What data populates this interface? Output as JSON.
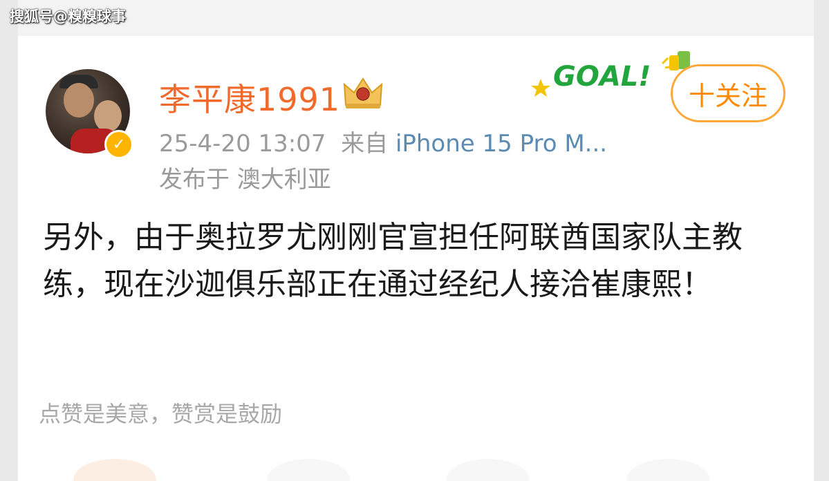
{
  "watermark": "搜狐号@糗糗球事",
  "post": {
    "username": "李平康1991",
    "timestamp": "25-4-20 13:07",
    "source_prefix": "来自",
    "device": "iPhone 15 Pro M...",
    "location": "发布于 澳大利亚",
    "text": "另外，由于奥拉罗尤刚刚官宣担任阿联酋国家队主教练，现在沙迦俱乐部正在通过经纪人接洽崔康熙！",
    "goal_badge": "GOAL!",
    "follow_label": "十关注",
    "reward_tip": "点赞是美意，赞赏是鼓励"
  },
  "colors": {
    "username": "#f06a2c",
    "follow_border": "#ffa83a",
    "follow_text": "#ff8a00",
    "goal_text": "#22a53c",
    "device_link": "#5b8ab3"
  },
  "icons": {
    "verified": "verified-badge-icon",
    "vip": "crown-icon",
    "goal": "goal-badge-icon"
  }
}
